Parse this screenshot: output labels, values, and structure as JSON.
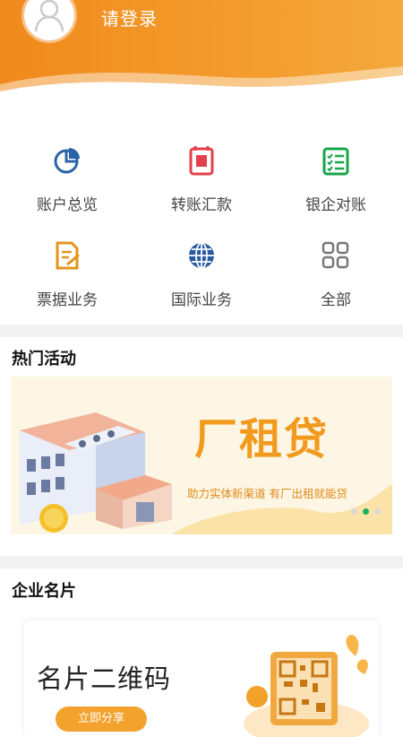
{
  "header": {
    "login_label": "请登录"
  },
  "menu": [
    {
      "label": "账户总览",
      "icon": "pie-chart-icon"
    },
    {
      "label": "转账汇款",
      "icon": "phone-transfer-icon"
    },
    {
      "label": "银企对账",
      "icon": "checklist-icon"
    },
    {
      "label": "票据业务",
      "icon": "document-edit-icon"
    },
    {
      "label": "国际业务",
      "icon": "globe-icon"
    },
    {
      "label": "全部",
      "icon": "grid-icon"
    }
  ],
  "sections": {
    "hot": "热门活动",
    "card": "企业名片"
  },
  "banner": {
    "title": "厂租贷",
    "subtitle": "助力实体新渠道  有厂出租就能贷",
    "active_dot": 2,
    "dot_count": 3
  },
  "card": {
    "title": "名片二维码",
    "button": "立即分享"
  },
  "colors": {
    "brand": "#f08a1c",
    "blue": "#2a63a8",
    "red": "#e2414b",
    "green": "#1aa34a",
    "orange": "#e3951e",
    "gray": "#777777",
    "dot_active": "#19b25c"
  }
}
